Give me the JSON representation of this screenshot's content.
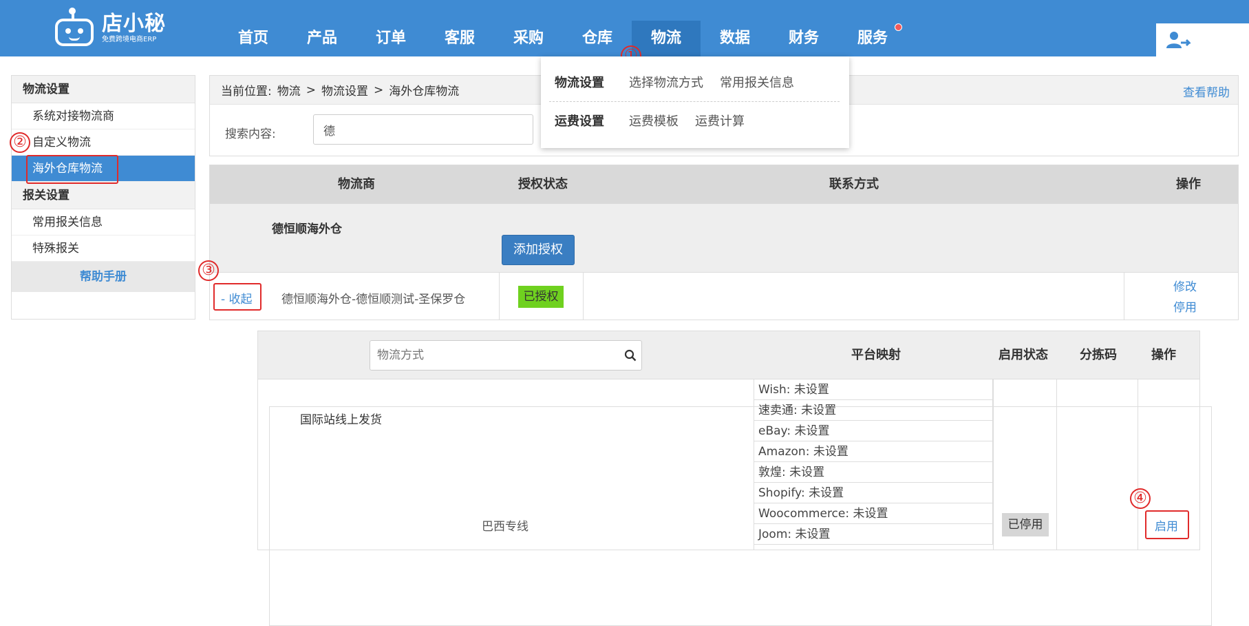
{
  "app": {
    "logo_name": "店小秘",
    "logo_sub": "免费跨境电商ERP"
  },
  "nav": [
    "首页",
    "产品",
    "订单",
    "客服",
    "采购",
    "仓库",
    "物流",
    "数据",
    "财务",
    "服务"
  ],
  "dropdown": {
    "row1_head": "物流设置",
    "row1_links": [
      "选择物流方式",
      "常用报关信息"
    ],
    "row2_head": "运费设置",
    "row2_links": [
      "运费模板",
      "运费计算"
    ]
  },
  "callouts": [
    "①",
    "②",
    "③",
    "④"
  ],
  "sidebar": {
    "section1": "物流设置",
    "item1": "系统对接物流商",
    "item2": "自定义物流",
    "item3": "海外仓库物流",
    "section2": "报关设置",
    "item4": "常用报关信息",
    "item5": "特殊报关",
    "item6": "国际站线上发货",
    "help": "帮助手册"
  },
  "breadcrumb": {
    "label": "当前位置:",
    "c1": "物流",
    "sep": ">",
    "c2": "物流设置",
    "c3": "海外仓库物流",
    "help": "查看帮助"
  },
  "search": {
    "label": "搜索内容:",
    "value": "德"
  },
  "table": {
    "headers": [
      "物流商",
      "授权状态",
      "联系方式",
      "操作"
    ],
    "provider": "德恒顺海外仓",
    "add_auth": "添加授权",
    "collapse": "- 收起",
    "warehouse": "德恒顺海外仓-德恒顺测试-圣保罗仓",
    "auth_status": "已授权",
    "op_edit": "修改",
    "op_disable": "停用"
  },
  "subtable": {
    "search_placeholder": "物流方式",
    "headers": [
      "平台映射",
      "启用状态",
      "分拣码",
      "操作"
    ],
    "method": "巴西专线",
    "mappings": [
      "Wish:  未设置",
      "速卖通:  未设置",
      "eBay:  未设置",
      "Amazon:  未设置",
      "敦煌:  未设置",
      "Shopify:  未设置",
      "Woocommerce:  未设置",
      "Joom:  未设置"
    ],
    "status": "已停用",
    "enable": "启用"
  }
}
